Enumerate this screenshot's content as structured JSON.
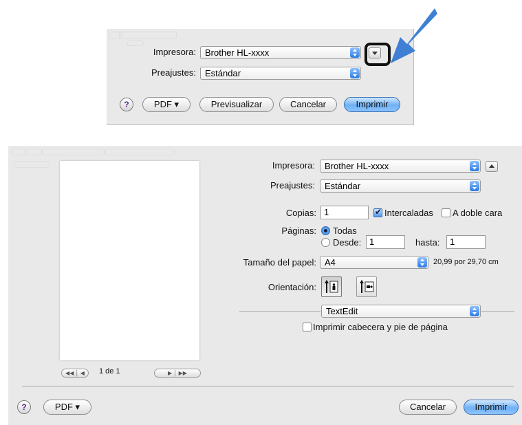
{
  "compact_dialog": {
    "printer_label": "Impresora:",
    "printer_value": "Brother HL-xxxx",
    "presets_label": "Preajustes:",
    "presets_value": "Estándar",
    "help": "?",
    "pdf": "PDF ▾",
    "preview": "Previsualizar",
    "cancel": "Cancelar",
    "print": "Imprimir"
  },
  "expanded_dialog": {
    "printer_label": "Impresora:",
    "printer_value": "Brother HL-xxxx",
    "presets_label": "Preajustes:",
    "presets_value": "Estándar",
    "copies_label": "Copias:",
    "copies_value": "1",
    "collated_label": "Intercaladas",
    "collated_checked": true,
    "two_sided_label": "A doble cara",
    "two_sided_checked": false,
    "pages_label": "Páginas:",
    "pages_all": "Todas",
    "pages_from": "Desde:",
    "pages_from_value": "1",
    "pages_to": "hasta:",
    "pages_to_value": "1",
    "paper_size_label": "Tamaño del papel:",
    "paper_size_value": "A4",
    "paper_size_dims": "20,99 por 29,70 cm",
    "orientation_label": "Orientación:",
    "app_section": "TextEdit",
    "header_footer_label": "Imprimir cabecera y pie de página",
    "page_indicator": "1 de 1",
    "help": "?",
    "pdf": "PDF ▾",
    "cancel": "Cancelar",
    "print": "Imprimir"
  },
  "colors": {
    "callout_arrow": "#3f7fd4",
    "dialog_bg": "#e9e9e9",
    "default_button": "#6fb0f5"
  }
}
